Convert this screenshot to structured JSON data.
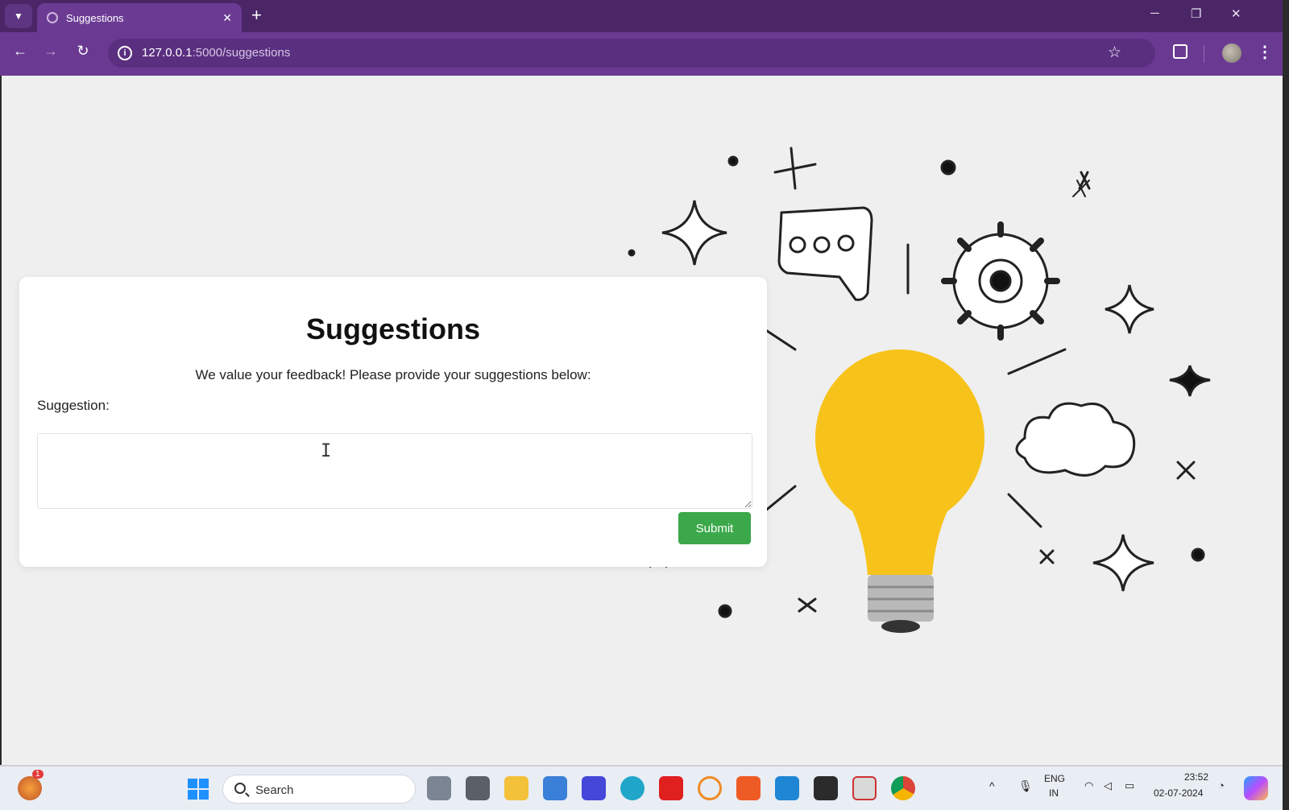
{
  "browser": {
    "tab_title": "Suggestions",
    "url_host": "127.0.0.1",
    "url_rest": ":5000/suggestions"
  },
  "page": {
    "title": "Suggestions",
    "subtitle": "We value your feedback! Please provide your suggestions below:",
    "field_label": "Suggestion:",
    "textarea_value": "",
    "submit_label": "Submit"
  },
  "taskbar": {
    "search_label": "Search",
    "lang_top": "ENG",
    "lang_bottom": "IN",
    "time": "23:52",
    "date": "02-07-2024",
    "notification_count": "1"
  },
  "colors": {
    "browser_accent": "#6a3a92",
    "submit_button": "#3ba84a",
    "bulb": "#f7c31a"
  }
}
